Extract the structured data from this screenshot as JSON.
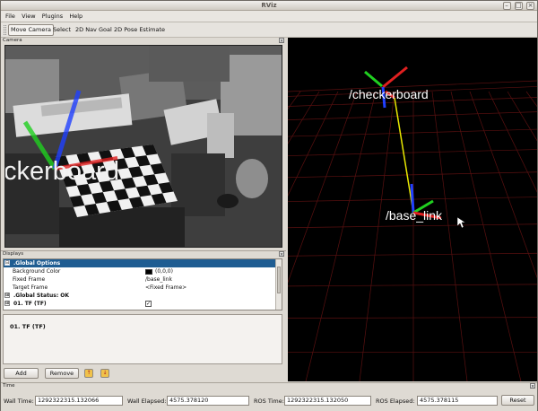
{
  "window": {
    "title": "RViz",
    "buttons": {
      "min": "–",
      "max": "□",
      "close": "×"
    }
  },
  "menu": [
    "File",
    "View",
    "Plugins",
    "Help"
  ],
  "toolbar": {
    "tools": [
      "Move Camera",
      "Select",
      "2D Nav Goal",
      "2D Pose Estimate"
    ],
    "active": "Move Camera"
  },
  "camera_panel": {
    "title": "Camera",
    "close": "×",
    "overlay_label": "ckerboard"
  },
  "displays": {
    "title": "Displays",
    "close": "×",
    "rows": [
      {
        "expander": "⊟",
        "key": ".Global Options",
        "value": ""
      },
      {
        "key": "Background Color",
        "value": "(0,0,0)"
      },
      {
        "key": "Fixed Frame",
        "value": "/base_link"
      },
      {
        "key": "Target Frame",
        "value": "<Fixed Frame>"
      },
      {
        "expander": "⊞",
        "key": ".Global Status: OK",
        "value": ""
      },
      {
        "expander": "⊞",
        "key": "01. TF (TF)",
        "value": "✓"
      }
    ],
    "description": "01. TF (TF)",
    "buttons": {
      "add": "Add",
      "remove": "Remove",
      "up": "↑",
      "down": "↓"
    }
  },
  "render_panel": {
    "frames": [
      "/checkerboard",
      "/base_link"
    ]
  },
  "time": {
    "title": "Time",
    "close": "×",
    "wall_time_label": "Wall Time:",
    "wall_time": "1292322315.132066",
    "wall_elapsed_label": "Wall Elapsed:",
    "wall_elapsed": "4575.378120",
    "ros_time_label": "ROS Time:",
    "ros_time": "1292322315.132050",
    "ros_elapsed_label": "ROS Elapsed:",
    "ros_elapsed": "4575.378115",
    "reset": "Reset"
  },
  "colors": {
    "selection": "#1f5d92",
    "grid": "#5a1010",
    "tf_x": "#e02020",
    "tf_y": "#20d020",
    "tf_z": "#2040ff",
    "tf_link": "#e8e800"
  }
}
